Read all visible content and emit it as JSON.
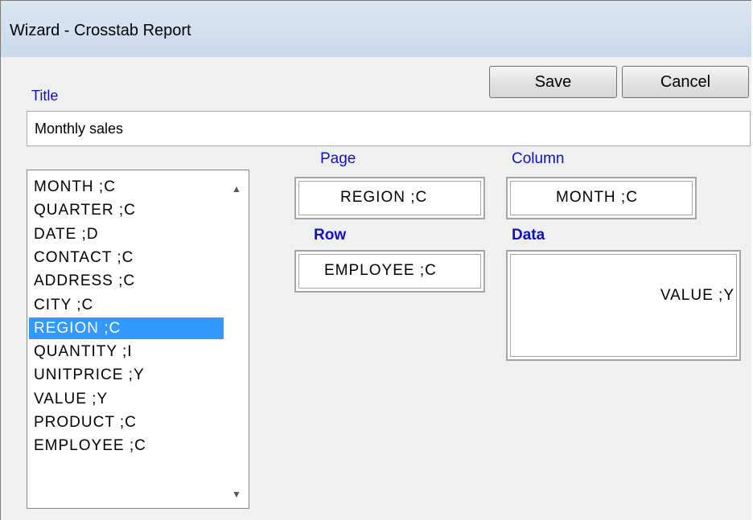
{
  "window": {
    "title": "Wizard - Crosstab Report"
  },
  "toolbar": {
    "save_label": "Save",
    "cancel_label": "Cancel"
  },
  "title_field": {
    "label": "Title",
    "value": "Monthly sales"
  },
  "fields": [
    "MONTH ;C",
    "QUARTER ;C",
    "DATE ;D",
    "CONTACT ;C",
    "ADDRESS ;C",
    "CITY ;C",
    "REGION ;C",
    "QUANTITY ;I",
    "UNITPRICE ;Y",
    "VALUE ;Y",
    "PRODUCT ;C",
    "EMPLOYEE ;C"
  ],
  "selected_field_index": 6,
  "zones": {
    "page": {
      "label": "Page",
      "value": "REGION ;C"
    },
    "column": {
      "label": "Column",
      "value": "MONTH ;C"
    },
    "row": {
      "label": "Row",
      "value": "EMPLOYEE ;C"
    },
    "data": {
      "label": "Data",
      "value": "VALUE ;Y"
    }
  },
  "icons": {
    "scroll_up": "up-arrow",
    "scroll_down": "down-arrow"
  },
  "colors": {
    "label_blue": "#1010c8",
    "selection": "#3399ff"
  }
}
